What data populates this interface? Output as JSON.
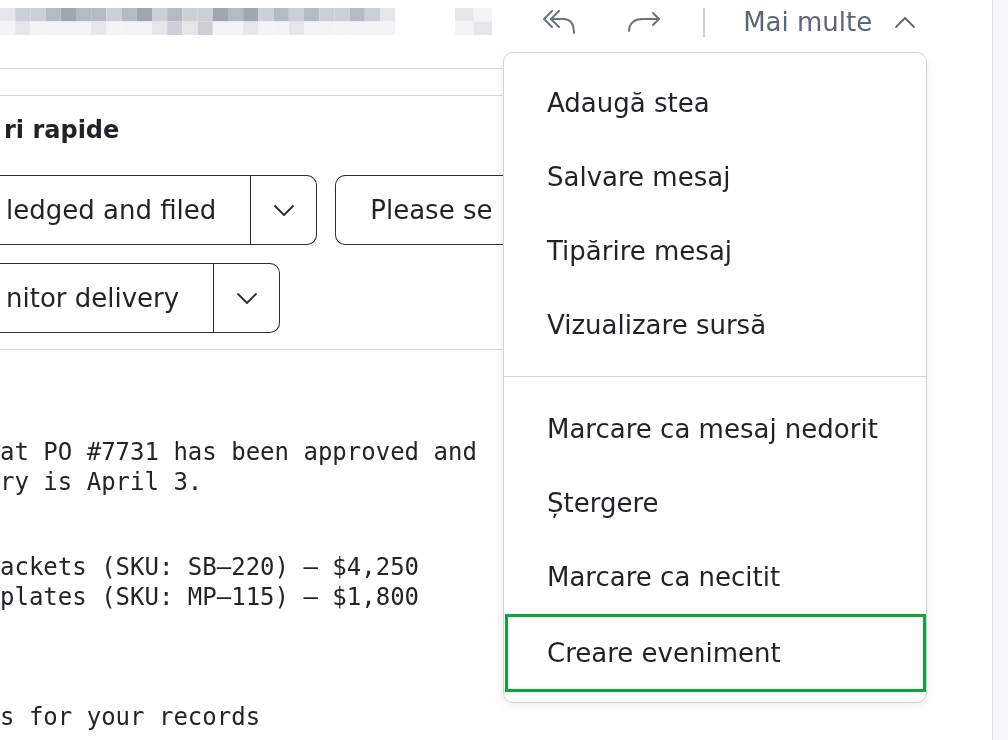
{
  "header": {
    "more_button": {
      "label": "Mai multe",
      "expanded": true
    }
  },
  "quick_replies": {
    "title": "ri rapide",
    "rows": [
      {
        "buttons": [
          {
            "label": "ledged and filed",
            "kind": "split"
          },
          {
            "label": "Please se",
            "kind": "plain"
          }
        ]
      },
      {
        "buttons": [
          {
            "label": "nitor delivery",
            "kind": "split"
          }
        ]
      }
    ]
  },
  "message": {
    "paragraphs": [
      {
        "lines": [
          "at PO #7731 has been approved and",
          "ry is April 3."
        ]
      },
      {
        "lines": [
          "ackets (SKU: SB–220) — $4,250",
          "plates (SKU: MP–115) — $1,800"
        ]
      },
      {
        "lines": [
          "s for your records"
        ]
      }
    ]
  },
  "more_menu": {
    "groups": [
      {
        "items": [
          {
            "label": "Adaugă stea",
            "selected": false
          },
          {
            "label": "Salvare mesaj",
            "selected": false
          },
          {
            "label": "Tipărire mesaj",
            "selected": false
          },
          {
            "label": "Vizualizare sursă",
            "selected": false
          }
        ]
      },
      {
        "items": [
          {
            "label": "Marcare ca mesaj nedorit",
            "selected": false
          },
          {
            "label": "Ștergere",
            "selected": false
          },
          {
            "label": "Marcare ca necitit",
            "selected": false
          },
          {
            "label": "Creare eveniment",
            "selected": true
          }
        ]
      }
    ]
  }
}
